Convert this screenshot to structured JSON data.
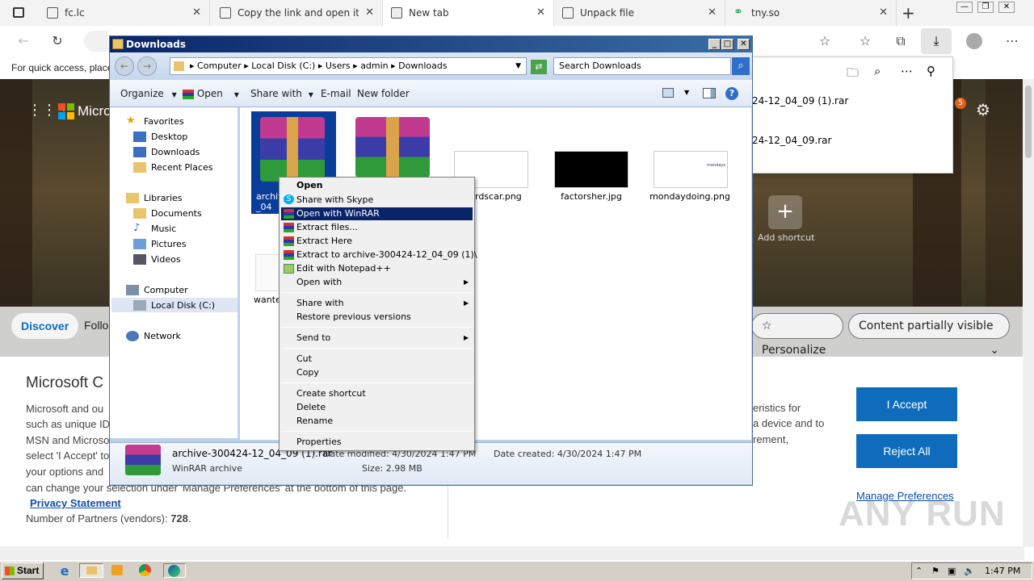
{
  "browser": {
    "tabs": [
      {
        "label": "fc.lc"
      },
      {
        "label": "Copy the link and open it in"
      },
      {
        "label": "New tab"
      },
      {
        "label": "Unpack file"
      },
      {
        "label": "tny.so"
      }
    ],
    "favbar_text": "For quick access, place"
  },
  "newtab": {
    "logo_text": "Micro",
    "add_shortcut": "Add shortcut",
    "feed_discover": "Discover",
    "feed_following": "Follo",
    "personalize": "Personalize",
    "content_visible": "Content partially visible",
    "badge_count": "5"
  },
  "downloads_panel": {
    "item1": "24-12_04_09 (1).rar",
    "item2": "24-12_04_09.rar"
  },
  "consent": {
    "title": "Microsoft C",
    "line1": "Microsoft and ou",
    "line2": "such as unique ID",
    "line3": "MSN and Microso",
    "line4": "select 'I Accept' to",
    "line5": "your options and",
    "line6": "can change your selection under 'Manage Preferences' at the bottom of this page.",
    "privacy_link": "Privacy Statement",
    "partners_label": "Number of Partners (vendors): ",
    "partners_count": "728",
    "right1": "eristics for",
    "right2": "a device and to",
    "right3": "rement,",
    "accept": "I Accept",
    "reject": "Reject All",
    "manage": "Manage Preferences"
  },
  "explorer": {
    "title": "Downloads",
    "breadcrumb": [
      "Computer",
      "Local Disk (C:)",
      "Users",
      "admin",
      "Downloads"
    ],
    "search_placeholder": "Search Downloads",
    "commands": {
      "organize": "Organize",
      "open": "Open",
      "share_with": "Share with",
      "email": "E-mail",
      "new_folder": "New folder"
    },
    "nav": {
      "favorites": "Favorites",
      "desktop": "Desktop",
      "downloads": "Downloads",
      "recent": "Recent Places",
      "libraries": "Libraries",
      "documents": "Documents",
      "music": "Music",
      "pictures": "Pictures",
      "videos": "Videos",
      "computer": "Computer",
      "local_disk": "Local Disk (C:)",
      "network": "Network"
    },
    "files": [
      {
        "name": "archiv\n_04"
      },
      {
        "name": ""
      },
      {
        "name": "rdscar.png"
      },
      {
        "name": "factorsher.jpg"
      },
      {
        "name": "mondaydoing.png"
      },
      {
        "name": "wante"
      }
    ],
    "thumb_text": "mondays",
    "detail": {
      "name": "archive-300424-12_04_09 (1).rar",
      "modified": "Date modified: 4/30/2024 1:47 PM",
      "created": "Date created: 4/30/2024 1:47 PM",
      "type": "WinRAR archive",
      "size": "Size: 2.98 MB"
    }
  },
  "context_menu": {
    "open": "Open",
    "skype": "Share with Skype",
    "winrar": "Open with WinRAR",
    "extract_files": "Extract files...",
    "extract_here": "Extract Here",
    "extract_to": "Extract to archive-300424-12_04_09 (1)\\",
    "notepad": "Edit with Notepad++",
    "open_with": "Open with",
    "share_with": "Share with",
    "restore": "Restore previous versions",
    "send_to": "Send to",
    "cut": "Cut",
    "copy": "Copy",
    "create_shortcut": "Create shortcut",
    "delete": "Delete",
    "rename": "Rename",
    "properties": "Properties"
  },
  "taskbar": {
    "start": "Start",
    "time": "1:47 PM"
  },
  "watermark": "ANY RUN"
}
